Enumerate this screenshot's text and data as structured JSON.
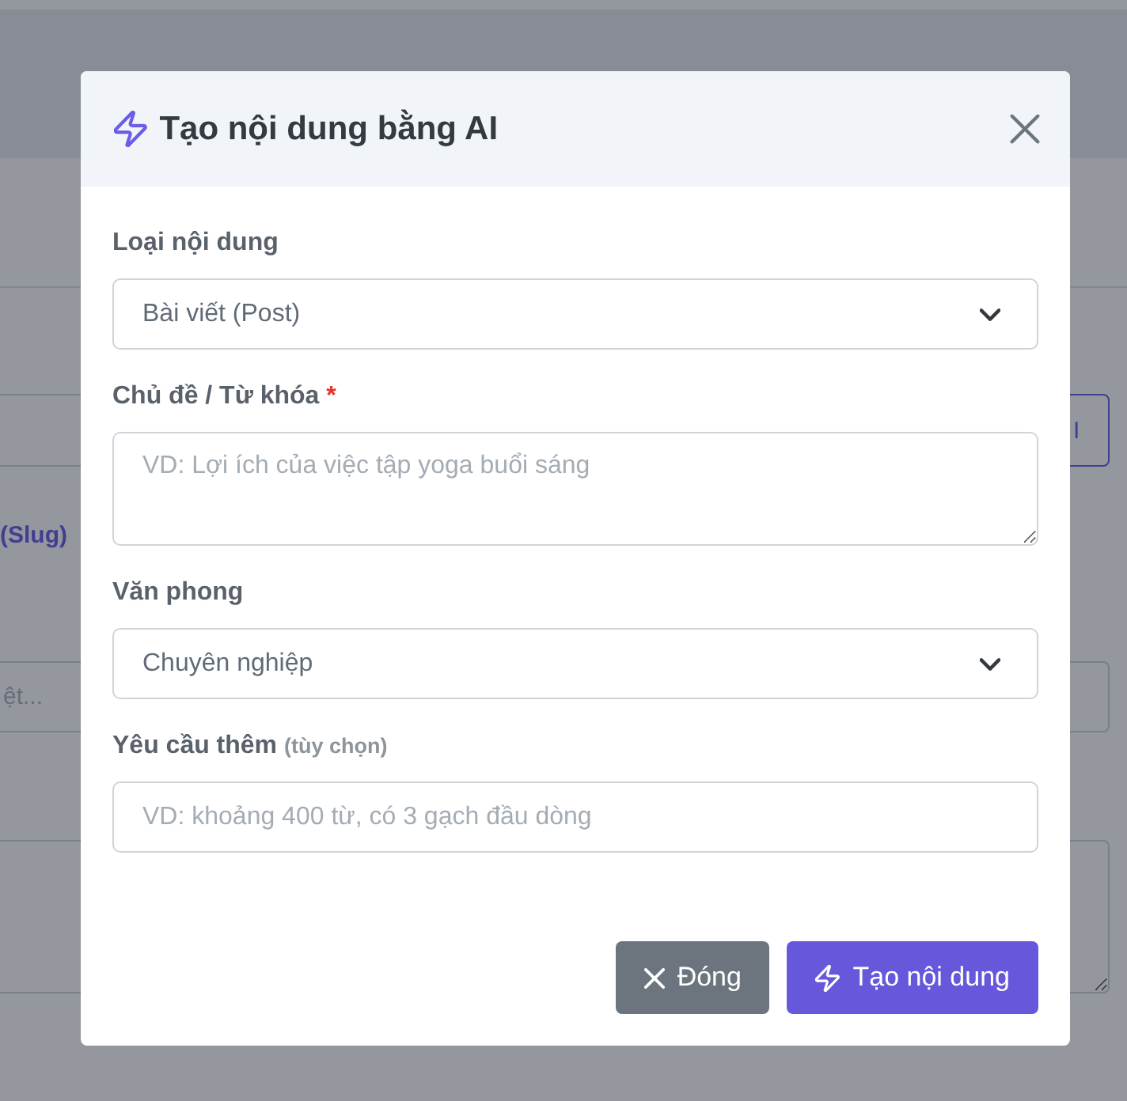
{
  "background_page": {
    "ai_button": "I",
    "slug_label": "(Slug)",
    "input_placeholder": "ệt..."
  },
  "modal": {
    "title": "Tạo nội dung bằng AI",
    "fields": [
      {
        "kind": "select",
        "label": "Loại nội dung",
        "value": "Bài viết (Post)"
      },
      {
        "kind": "textarea",
        "label": "Chủ đề / Từ khóa",
        "required_mark": "*",
        "placeholder": "VD: Lợi ích của việc tập yoga buổi sáng"
      },
      {
        "kind": "select",
        "label": "Văn phong",
        "value": "Chuyên nghiệp"
      },
      {
        "kind": "input",
        "label": "Yêu cầu thêm",
        "hint": "(tùy chọn)",
        "placeholder": "VD: khoảng 400 từ, có 3 gạch đầu dòng"
      }
    ],
    "buttons": [
      {
        "kind": "secondary",
        "label": "Đóng"
      },
      {
        "kind": "primary",
        "label": "Tạo nội dung"
      }
    ]
  }
}
